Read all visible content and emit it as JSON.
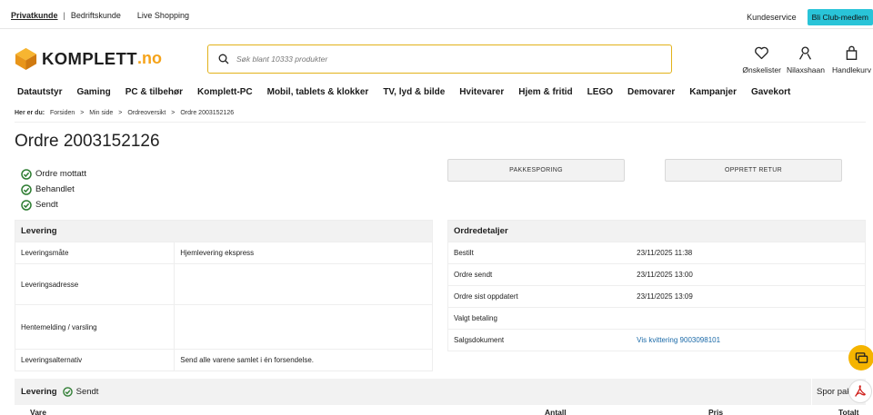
{
  "topbar": {
    "private": "Privatkunde",
    "separator": "|",
    "business": "Bedriftskunde",
    "live": "Live Shopping",
    "service": "Kundeservice",
    "club": "Bli Club-medlem"
  },
  "header": {
    "logo_word": "KOMPLETT",
    "logo_tld": ".no",
    "search_placeholder": "Søk blant 10333 produkter",
    "wishlist": "Ønskelister",
    "user": "Nilaxshaan",
    "cart": "Handlekurv"
  },
  "nav": [
    "Datautstyr",
    "Gaming",
    "PC & tilbehør",
    "Komplett-PC",
    "Mobil, tablets & klokker",
    "TV, lyd & bilde",
    "Hvitevarer",
    "Hjem & fritid",
    "LEGO",
    "Demovarer",
    "Kampanjer",
    "Gavekort"
  ],
  "breadcrumb": {
    "lead": "Her er du:",
    "items": [
      "Forsiden",
      "Min side",
      "Ordreoversikt",
      "Ordre 2003152126"
    ],
    "sep": ">"
  },
  "order": {
    "title": "Ordre 2003152126",
    "status": [
      "Ordre mottatt",
      "Behandlet",
      "Sendt"
    ],
    "track_button": "PAKKESPORING",
    "return_button": "OPPRETT RETUR"
  },
  "delivery_info": {
    "heading": "Levering",
    "rows": [
      {
        "label": "Leveringsmåte",
        "value": "Hjemlevering ekspress"
      },
      {
        "label": "Leveringsadresse",
        "value": ""
      },
      {
        "label": "Hentemelding / varsling",
        "value": ""
      },
      {
        "label": "Leveringsalternativ",
        "value": "Send alle varene samlet i én forsendelse."
      }
    ]
  },
  "order_details": {
    "heading": "Ordredetaljer",
    "rows": [
      {
        "label": "Bestilt",
        "value": "23/11/2025 11:38"
      },
      {
        "label": "Ordre sendt",
        "value": "23/11/2025 13:00"
      },
      {
        "label": "Ordre sist oppdatert",
        "value": "23/11/2025 13:09"
      },
      {
        "label": "Valgt betaling",
        "value": ""
      },
      {
        "label": "Salgsdokument",
        "value": "Vis kvittering 9003098101"
      }
    ]
  },
  "shipment": {
    "label": "Levering",
    "status": "Sendt",
    "track": "Spor pakke",
    "columns": [
      "Vare",
      "Antall",
      "Pris",
      "Totalt"
    ]
  },
  "colors": {
    "accent": "#f5a31a",
    "club": "#29c4d8",
    "success": "#2e7d32",
    "link": "#1b6aa8"
  }
}
